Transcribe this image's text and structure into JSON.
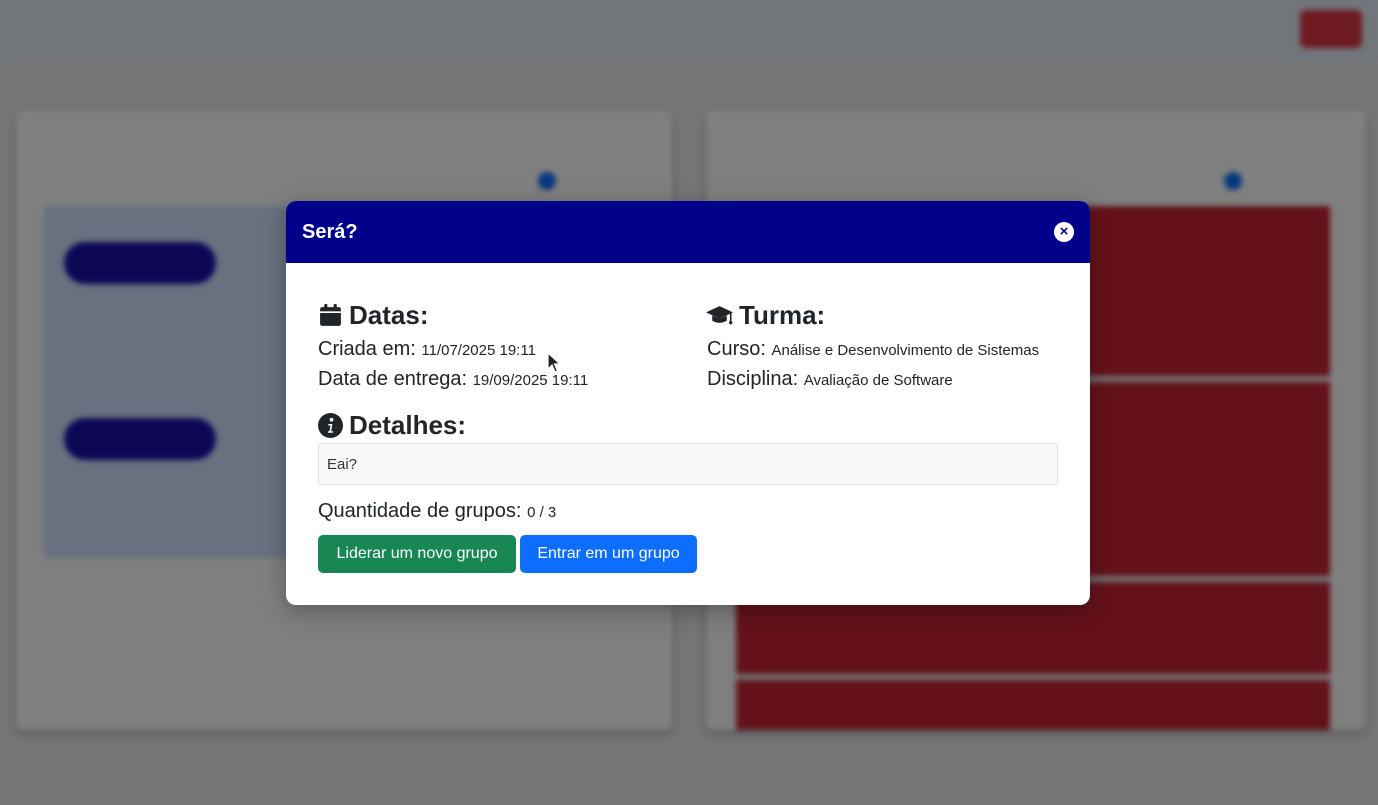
{
  "modal": {
    "title": "Será?",
    "close_label": "×",
    "datas": {
      "heading": "Datas:",
      "criada_label": "Criada em:",
      "criada_value": "11/07/2025 19:11",
      "entrega_label": "Data de entrega:",
      "entrega_value": "19/09/2025 19:11"
    },
    "turma": {
      "heading": "Turma:",
      "curso_label": "Curso:",
      "curso_value": "Análise e Desenvolvimento de Sistemas",
      "disciplina_label": "Disciplina:",
      "disciplina_value": "Avaliação de Software"
    },
    "detalhes": {
      "heading": "Detalhes:",
      "text": "Eai?"
    },
    "grupos": {
      "label": "Quantidade de grupos:",
      "value": "0 / 3"
    },
    "buttons": {
      "lead": "Liderar um novo grupo",
      "join": "Entrar em um grupo"
    }
  },
  "colors": {
    "modal_header": "#00008b",
    "lead_button": "#198754",
    "join_button": "#0d6efd",
    "late_area": "#c82333",
    "planned_area": "#cfe2ff"
  },
  "icons": {
    "datas": "calendar-icon",
    "turma": "graduation-cap-icon",
    "detalhes": "info-circle-icon",
    "close": "close-icon"
  }
}
